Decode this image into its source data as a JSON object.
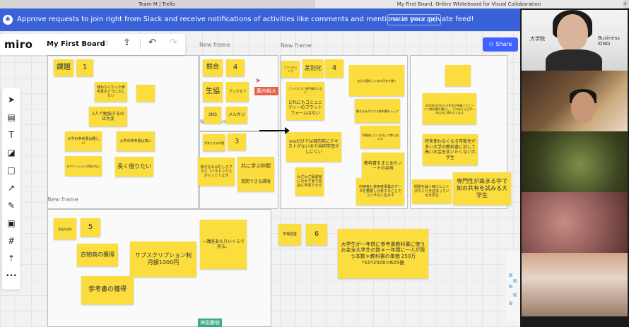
{
  "browser": {
    "tab1": "Team M | Trello",
    "tab2": "My First Board, Online Whiteboard for Visual Collaboration",
    "tab_plus": "+"
  },
  "banner": {
    "icon": "slack-icon",
    "text": "Approve requests to join right from Slack and receive notifications of activities like comments and mentions in your private feed!",
    "button": "Install Slack App"
  },
  "topbar": {
    "logo": "miro",
    "board_title": "My First Board",
    "star": "☆",
    "export": "⇪",
    "undo": "↶",
    "redo": "↷"
  },
  "share": {
    "label": "Share",
    "icon": "users-icon"
  },
  "toolbar": {
    "tools": [
      {
        "name": "select-tool",
        "glyph": "➤"
      },
      {
        "name": "templates-tool",
        "glyph": "▤"
      },
      {
        "name": "text-tool",
        "glyph": "T"
      },
      {
        "name": "sticky-note-tool",
        "glyph": "◪"
      },
      {
        "name": "shape-tool",
        "glyph": "□"
      },
      {
        "name": "arrow-tool",
        "glyph": "↗"
      },
      {
        "name": "pen-tool",
        "glyph": "✎"
      },
      {
        "name": "comment-tool",
        "glyph": "▣"
      },
      {
        "name": "frame-tool",
        "glyph": "#"
      },
      {
        "name": "upload-tool",
        "glyph": "⇡"
      },
      {
        "name": "more-tool",
        "glyph": "•••"
      }
    ]
  },
  "frames": {
    "label": "New frame"
  },
  "notes": {
    "n1": "課題",
    "n2": "1",
    "n3": "使わなくなった参考書をどうにかしたい",
    "n4": "",
    "n5": "1人で勉強するのは大変",
    "n6": "大学の参考書は難しい",
    "n7": "大学の参考書は高い",
    "n8": "モチベーションが続かない",
    "n9": "長く借りたい",
    "n10": "競合",
    "n11": "4",
    "n12": "生協",
    "n13": "ブックオフ",
    "n14": "SNS",
    "n15": "メルカリ",
    "n16": "共有できる仲間",
    "n17": "3",
    "n18": "書き込みはむしろプラス（パラドックスが入っててよき",
    "n19": "共に学ぶ仲間",
    "n20": "質問できる環境",
    "n21": "ブランディング",
    "n22": "差別化",
    "n23": "4",
    "n24": "ブックオフに専門書は少ない",
    "n25": "どれにもコミュニティーのプラットフォームはない",
    "n26": "snsだけでは目的前にテキストがないので共同学習がしにくい",
    "n27": "わざわざ図書館に行かず家で自由に学習できる",
    "n28": "自分が選択した本の目次を書く",
    "n29": "書き込みができる教科書をシェア",
    "n30": "予備校によくあるいて教え合える",
    "n31": "教科書をまとめたノートの共有",
    "n32": "利用者と使用者事業のデータを蓄積し分析することでコンサルに生かす",
    "n33": "",
    "n34": "2020年3月から大学生が授業ごとに一人で教科書を購入し、そのほとんどが一年以内に使わなくなる",
    "n35": "将来使わなくなる可能性が多い大学の教科書に対して高いお金を払いたくない大学生",
    "n36": "問題を解く時にヒントがなく行き詰まっている大学生",
    "n37": "専門性が高まる中で知の共有を試みる大学生",
    "n38": "収益の流れ",
    "n39": "5",
    "n40": "古物商の獲得",
    "n41": "サブスクリプション制 月額1000円",
    "n42": "一講座あたりいくらで売る。",
    "n43": "参考書の獲得",
    "n44": "市場調査",
    "n45": "6",
    "n46": "大学生が一年間に参考書教科書に使うお金全大学生の数＊一年間に一人が買う本数＊教科書の単価 250万*10*2500=625億"
  },
  "collab": {
    "cursor_user": "藪内裕大",
    "bottom_user": "神田慶樹"
  },
  "video": {
    "sign_left": "大学院",
    "sign_right": "Business KING"
  }
}
